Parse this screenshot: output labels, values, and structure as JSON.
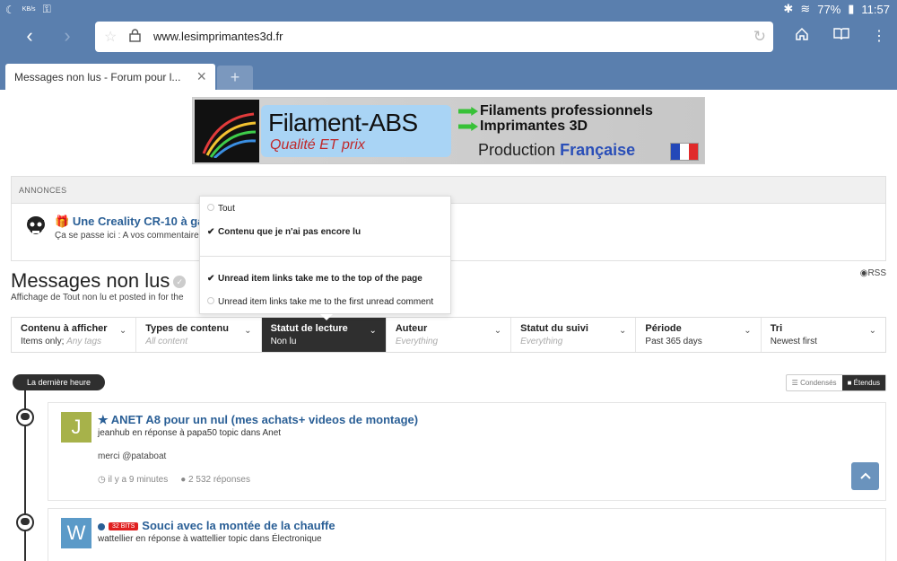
{
  "statusbar": {
    "battery": "77%",
    "time": "11:57",
    "net": "KB/s"
  },
  "browser": {
    "url": "www.lesimprimantes3d.fr",
    "tab_title": "Messages non lus - Forum pour l...",
    "new_tab": "+"
  },
  "banner": {
    "brand": "Filament-ABS",
    "tagline": "Qualité ET prix",
    "line1": "Filaments professionnels",
    "line2": "Imprimantes 3D",
    "production": "Production",
    "francaise": "Française"
  },
  "annonces": {
    "header": "ANNONCES",
    "title": "Une Creality CR-10 à gagn",
    "subtitle": "Ça se passe ici : A vos commentaire"
  },
  "page": {
    "title": "Messages non lus",
    "subtitle": "Affichage de Tout non lu et posted in for the",
    "rss": "RSS"
  },
  "dropdown": {
    "opt_all": "Tout",
    "opt_unread": "Contenu que je n'ai pas encore lu",
    "opt_top": "Unread item links take me to the top of the page",
    "opt_first": "Unread item links take me to the first unread comment"
  },
  "filters": [
    {
      "label": "Contenu à afficher",
      "value": "Items only;",
      "value_em": "Any tags"
    },
    {
      "label": "Types de contenu",
      "value": "",
      "value_em": "All content"
    },
    {
      "label": "Statut de lecture",
      "value": "Non lu",
      "value_em": ""
    },
    {
      "label": "Auteur",
      "value": "",
      "value_em": "Everything"
    },
    {
      "label": "Statut du suivi",
      "value": "",
      "value_em": "Everything"
    },
    {
      "label": "Période",
      "value": "Past 365 days",
      "value_em": ""
    },
    {
      "label": "Tri",
      "value": "Newest first",
      "value_em": ""
    }
  ],
  "timeline": {
    "pill": "La dernière heure",
    "view_condensed": "Condensés",
    "view_expanded": "Étendus"
  },
  "posts": [
    {
      "avatar_letter": "J",
      "avatar_color": "#a7b24a",
      "title": "ANET A8 pour un nul (mes achats+ videos de montage)",
      "subtitle": "jeanhub en réponse à papa50 topic dans Anet",
      "body": "merci @pataboat",
      "time": "il y a 9 minutes",
      "replies": "2 532 réponses"
    },
    {
      "avatar_letter": "W",
      "avatar_color": "#5b9ac8",
      "badge": "32 BITS",
      "title": "Souci avec la montée de la chauffe",
      "subtitle": "wattellier en réponse à wattellier topic dans Électronique"
    }
  ],
  "colors": {
    "chrome": "#5a7fae",
    "link": "#2a5f96",
    "dark": "#2f2f2f"
  }
}
